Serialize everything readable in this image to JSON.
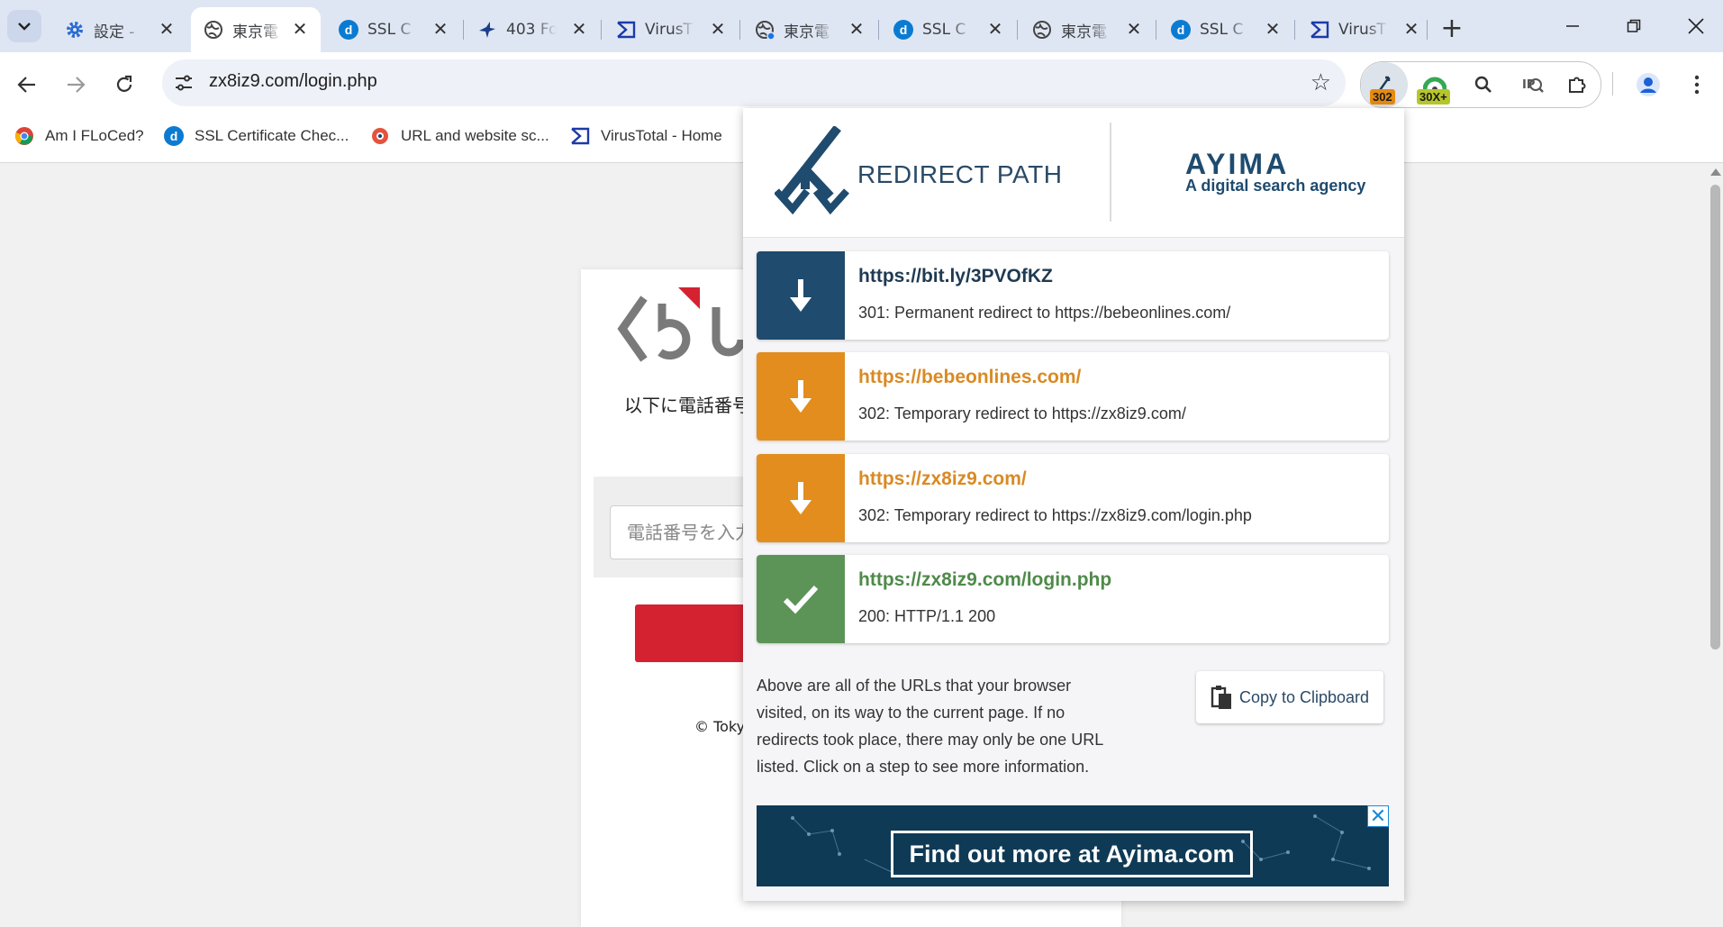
{
  "tabs": [
    {
      "title": "設定 - ",
      "favicon": "gear-icon",
      "active": false
    },
    {
      "title": "東京電",
      "favicon": "globe-icon",
      "active": true
    },
    {
      "title": "SSL C",
      "favicon": "d-icon",
      "active": false
    },
    {
      "title": "403 Fo",
      "favicon": "bird-icon",
      "active": false
    },
    {
      "title": "VirusT",
      "favicon": "virustotal-icon",
      "active": false
    },
    {
      "title": "東京電",
      "favicon": "globe-icon",
      "active": false
    },
    {
      "title": "SSL C",
      "favicon": "d-icon",
      "active": false
    },
    {
      "title": "東京電",
      "favicon": "globe-icon",
      "active": false
    },
    {
      "title": "SSL C",
      "favicon": "d-icon",
      "active": false
    },
    {
      "title": "VirusT",
      "favicon": "virustotal-icon",
      "active": false
    }
  ],
  "address_bar": {
    "url": "zx8iz9.com/login.php"
  },
  "extensions": {
    "redirect_badge": "302",
    "seo_badge": "30X+"
  },
  "bookmarks": [
    {
      "label": "Am I FLoCed?",
      "icon": "chrome-icon"
    },
    {
      "label": "SSL Certificate Chec...",
      "icon": "d-icon"
    },
    {
      "label": "URL and website sc...",
      "icon": "urlscan-icon"
    },
    {
      "label": "VirusTotal - Home",
      "icon": "virustotal-icon"
    }
  ],
  "page": {
    "instruction": "以下に電話番号",
    "phone_placeholder": "電話番号を入力",
    "copyright": "© Toky"
  },
  "popup": {
    "header": {
      "title": "REDIRECT PATH",
      "partner_name": "AYIMA",
      "partner_tagline": "A digital search agency"
    },
    "hops": [
      {
        "url": "https://bit.ly/3PVOfKZ",
        "detail": "301: Permanent redirect to https://bebeonlines.com/",
        "color": "#1f4b6e",
        "text_color": "#1f3a52",
        "icon": "arrow-down-icon"
      },
      {
        "url": "https://bebeonlines.com/",
        "detail": "302: Temporary redirect to https://zx8iz9.com/",
        "color": "#e28d1d",
        "text_color": "#d98a24",
        "icon": "arrow-down-icon"
      },
      {
        "url": "https://zx8iz9.com/",
        "detail": "302: Temporary redirect to https://zx8iz9.com/login.php",
        "color": "#e28d1d",
        "text_color": "#d98a24",
        "icon": "arrow-down-icon"
      },
      {
        "url": "https://zx8iz9.com/login.php",
        "detail": "200: HTTP/1.1 200",
        "color": "#5c9458",
        "text_color": "#4f8a4a",
        "icon": "check-icon"
      }
    ],
    "info_text": "Above are all of the URLs that your browser visited, on its way to the current page. If no redirects took place, there may only be one URL listed. Click on a step to see more information.",
    "copy_label": "Copy to Clipboard",
    "ad_text": "Find out more at Ayima.com"
  }
}
